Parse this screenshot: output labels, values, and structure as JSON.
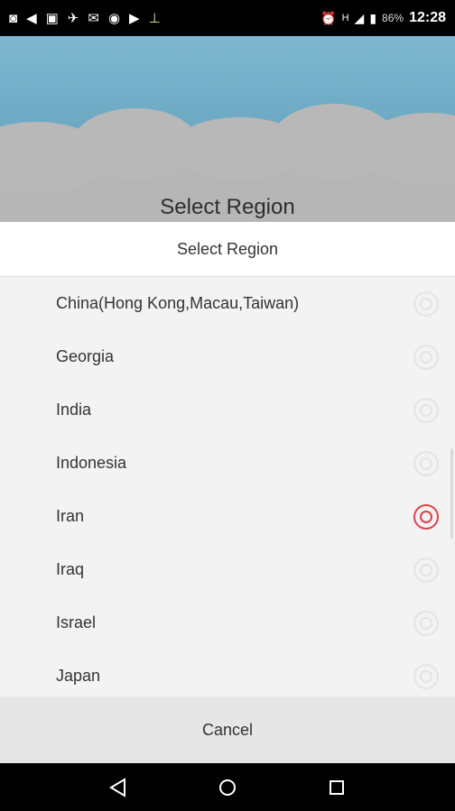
{
  "status_bar": {
    "left_icons": [
      "instagram-icon",
      "telegram-icon",
      "gallery-icon",
      "messenger-icon",
      "mail-icon",
      "chrome-icon",
      "play-store-icon",
      "download-icon"
    ],
    "network": "H",
    "battery_percent": "86%",
    "time": "12:28"
  },
  "background": {
    "title": "Select Region"
  },
  "dialog": {
    "title": "Select Region",
    "items": [
      {
        "label": "China(Hong Kong,Macau,Taiwan)",
        "selected": false
      },
      {
        "label": "Georgia",
        "selected": false
      },
      {
        "label": "India",
        "selected": false
      },
      {
        "label": "Indonesia",
        "selected": false
      },
      {
        "label": "Iran",
        "selected": true
      },
      {
        "label": "Iraq",
        "selected": false
      },
      {
        "label": "Israel",
        "selected": false
      },
      {
        "label": "Japan",
        "selected": false
      }
    ],
    "cancel_label": "Cancel"
  },
  "nav_bar": {
    "icons": [
      "back-icon",
      "home-icon",
      "recents-icon"
    ]
  },
  "colors": {
    "accent": "#e0404a",
    "sky": "#6aa7c2"
  }
}
